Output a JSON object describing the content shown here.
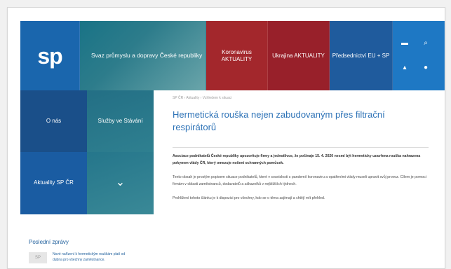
{
  "header": {
    "logo_text": "sp",
    "headline": "Svaz průmyslu a dopravy České republiky",
    "tiles": [
      {
        "label": "Koronavirus AKTUALITY"
      },
      {
        "label": "Ukrajina AKTUALITY"
      },
      {
        "label": "Předsednictví EU + SP"
      }
    ]
  },
  "nav": [
    {
      "label": "O nás"
    },
    {
      "label": "Služby ve Stávání"
    },
    {
      "label": "Aktuality SP ČR"
    },
    {
      "label": "⌄"
    }
  ],
  "utility_icons": [
    "menu-icon",
    "search-icon",
    "user-icon",
    "globe-icon"
  ],
  "breadcrumb": "SP ČR › Aktuality › Vzhledem k situaci",
  "article": {
    "title": "Hermetická rouška nejen zabudovaným přes filtrační respirátorů",
    "paragraphs": [
      "Asociace podnikatelů České republiky upozorňuje firmy a jednotlivce, že počínaje 15. 4. 2020 nesmí být hermeticky uzavřena rouška nahrazena pokynem vlády ČR, který omezuje nošení ochranných pomůcek.",
      "Tento obsah je prostým popisem situace podnikatelů, které v souvislosti s pandemií koronaviru a opatřeními vlády museli upravit svůj provoz. Cílem je pomoci firmám v oblasti zaměstnanců, dodavatelů a zákazníků v nejbližších týdnech.",
      "Prohlížení tohoto článku je k dispozici pro všechny, kdo se o téma zajímají a chtějí mít přehled."
    ]
  },
  "sidebar": {
    "heading": "Poslední zprávy",
    "items": [
      {
        "thumb": "SP",
        "text": "Nové nařízení k hermetickým rouškám platí od dubna pro všechny zaměstnance."
      }
    ]
  }
}
